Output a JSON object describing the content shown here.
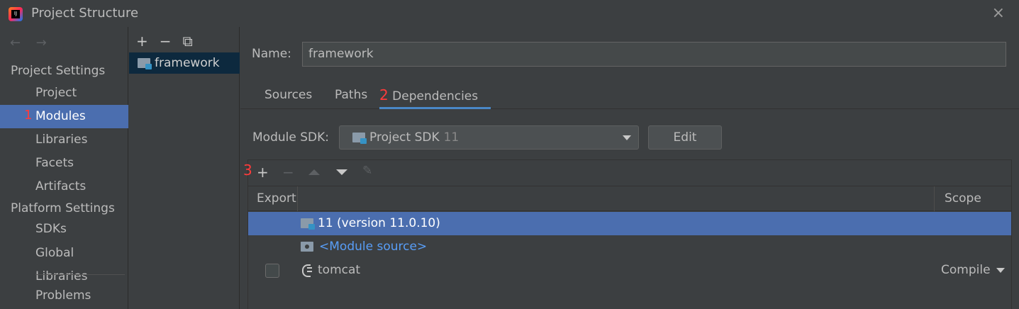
{
  "window": {
    "title": "Project Structure",
    "close_icon": "×",
    "app_icon_label": "IJ"
  },
  "sidebar": {
    "back_forward": "← →",
    "project_settings_header": "Project Settings",
    "items_project": [
      {
        "label": "Project",
        "selected": false
      },
      {
        "label": "Modules",
        "selected": true,
        "annotation": "1"
      },
      {
        "label": "Libraries",
        "selected": false
      },
      {
        "label": "Facets",
        "selected": false
      },
      {
        "label": "Artifacts",
        "selected": false
      }
    ],
    "platform_settings_header": "Platform Settings",
    "items_platform": [
      {
        "label": "SDKs"
      },
      {
        "label": "Global Libraries"
      }
    ],
    "problems_label": "Problems"
  },
  "module_list": {
    "toolbar": {
      "add": "+",
      "remove": "−",
      "copy": "⧉"
    },
    "items": [
      {
        "label": "framework",
        "selected": true
      }
    ]
  },
  "main": {
    "name_label": "Name:",
    "name_value": "framework",
    "tabs": [
      {
        "label": "Sources",
        "active": false
      },
      {
        "label": "Paths",
        "active": false
      },
      {
        "label": "Dependencies",
        "active": true,
        "annotation": "2"
      }
    ],
    "module_sdk_label": "Module SDK:",
    "module_sdk_value": "Project SDK",
    "module_sdk_version": "11",
    "edit_button": "Edit",
    "toolbar_annotation": "3",
    "dep_table": {
      "col_export": "Export",
      "col_scope": "Scope",
      "rows": [
        {
          "label": "11 (version 11.0.10)",
          "selected": true,
          "kind": "sdk"
        },
        {
          "label": "<Module source>",
          "selected": false,
          "kind": "module-source"
        },
        {
          "label": "tomcat",
          "selected": false,
          "kind": "library",
          "scope": "Compile",
          "export": false
        }
      ]
    }
  },
  "colors": {
    "selection": "#4b6eaf",
    "annotation": "#ff3b3b",
    "link": "#589df6",
    "tab_underline": "#4a88c7"
  }
}
